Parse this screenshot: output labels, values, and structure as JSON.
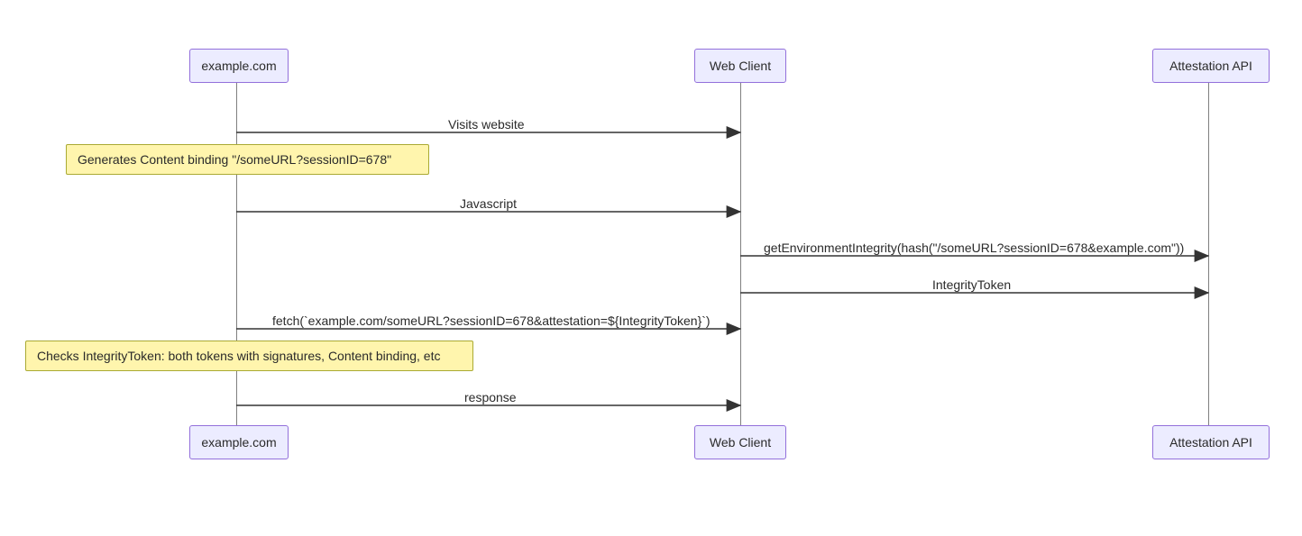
{
  "participants": {
    "p0": "example.com",
    "p1": "Web Client",
    "p2": "Attestation API"
  },
  "messages": {
    "m1": "Visits website",
    "m2": "Javascript",
    "m3": "getEnvironmentIntegrity(hash(\"/someURL?sessionID=678&example.com\"))",
    "m4": "IntegrityToken",
    "m5": "fetch(`example.com/someURL?sessionID=678&attestation=${IntegrityToken}`)",
    "m6": "response"
  },
  "notes": {
    "n1": "Generates Content binding \"/someURL?sessionID=678\"",
    "n2": "Checks IntegrityToken: both tokens with signatures, Content binding, etc"
  },
  "chart_data": {
    "type": "sequence-diagram",
    "participants": [
      "example.com",
      "Web Client",
      "Attestation API"
    ],
    "events": [
      {
        "type": "message",
        "from": "Web Client",
        "to": "example.com",
        "label": "Visits website"
      },
      {
        "type": "note",
        "over": "example.com",
        "text": "Generates Content binding \"/someURL?sessionID=678\""
      },
      {
        "type": "message",
        "from": "example.com",
        "to": "Web Client",
        "label": "Javascript"
      },
      {
        "type": "message",
        "from": "Web Client",
        "to": "Attestation API",
        "label": "getEnvironmentIntegrity(hash(\"/someURL?sessionID=678&example.com\"))"
      },
      {
        "type": "message",
        "from": "Attestation API",
        "to": "Web Client",
        "label": "IntegrityToken"
      },
      {
        "type": "message",
        "from": "Web Client",
        "to": "example.com",
        "label": "fetch(`example.com/someURL?sessionID=678&attestation=${IntegrityToken}`)"
      },
      {
        "type": "note",
        "over": "example.com",
        "text": "Checks IntegrityToken: both tokens with signatures, Content binding, etc"
      },
      {
        "type": "message",
        "from": "example.com",
        "to": "Web Client",
        "label": "response"
      }
    ]
  }
}
